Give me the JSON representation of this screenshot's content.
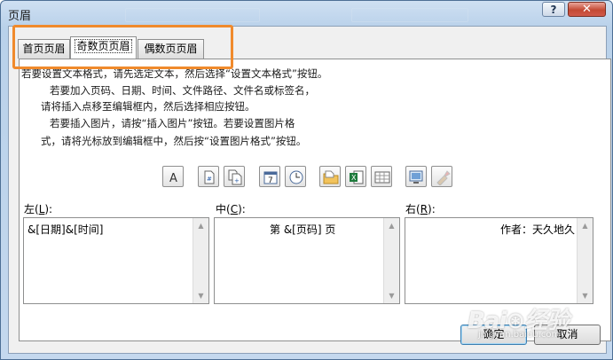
{
  "window": {
    "title": "页眉",
    "help_label": "?",
    "close_label": "✕"
  },
  "tabs": [
    {
      "label": "首页页眉",
      "active": false
    },
    {
      "label": "奇数页页眉",
      "active": true
    },
    {
      "label": "偶数页页眉",
      "active": false
    }
  ],
  "instructions": [
    "若要设置文本格式，请先选定文本，然后选择“设置文本格式”按钮。",
    "若要加入页码、日期、时间、文件路径、文件名或标签名，",
    "请将插入点移至编辑框内，然后选择相应按钮。",
    "若要插入图片，请按“插入图片”按钮。若要设置图片格",
    "式，请将光标放到编辑框中，然后按“设置图片格式”按钮。"
  ],
  "toolbar": [
    {
      "icon": "format-text-icon"
    },
    {
      "icon": "insert-page-number-icon"
    },
    {
      "icon": "insert-page-count-icon"
    },
    {
      "icon": "insert-date-icon"
    },
    {
      "icon": "insert-time-icon"
    },
    {
      "icon": "insert-file-path-icon"
    },
    {
      "icon": "insert-file-name-icon"
    },
    {
      "icon": "insert-sheet-name-icon"
    },
    {
      "icon": "insert-picture-icon"
    },
    {
      "icon": "format-picture-icon"
    }
  ],
  "sections": {
    "left": {
      "label_pre": "左(",
      "key": "L",
      "label_post": "):",
      "value": "&[日期]&[时间]"
    },
    "center": {
      "label_pre": "中(",
      "key": "C",
      "label_post": "):",
      "value": "第 &[页码] 页"
    },
    "right": {
      "label_pre": "右(",
      "key": "R",
      "label_post": "):",
      "value": "作者：天久地久"
    }
  },
  "buttons": {
    "ok": "确定",
    "cancel": "取消"
  },
  "watermark": {
    "logo": "Bai⊛经验",
    "url": "jingyan.baidu.com"
  },
  "colors": {
    "highlight": "#f08a2c",
    "frame": "#b9d1ea",
    "close": "#c44a34"
  }
}
